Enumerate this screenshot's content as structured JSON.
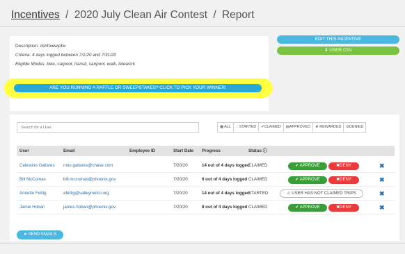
{
  "breadcrumb": {
    "root": "Incentives",
    "separator": "/",
    "contest": "2020 July Clean Air Contest",
    "page": "Report"
  },
  "description": {
    "description_line": "Description: dshfoiewjofei",
    "criteria_line": "Criteria: 4 days logged between 7/1/20 and 7/31/20",
    "modes_line": "Eligible Modes: bike, carpool, transit, vanpool, walk, telework"
  },
  "raffle_button": "ARE YOU RUNNING A RAFFLE OR SWEEPSTAKES? CLICK TO PICK YOUR WINNER!",
  "side_buttons": {
    "edit": "EDIT THIS INCENTIVE",
    "csv": "USER CSV"
  },
  "search": {
    "placeholder": "Search for a User"
  },
  "filters": [
    {
      "label": "ALL",
      "icon": "grid-icon"
    },
    {
      "label": "STARTED",
      "icon": "circle-notch-icon"
    },
    {
      "label": "CLAIMED",
      "icon": "check-icon"
    },
    {
      "label": "APPROVED",
      "icon": "clipboard-icon"
    },
    {
      "label": "REWARDED",
      "icon": "star-icon"
    },
    {
      "label": "DENIED",
      "icon": "ban-icon"
    }
  ],
  "table": {
    "headers": {
      "user": "User",
      "email": "Email",
      "employee_id": "Employee ID",
      "start_date": "Start Date",
      "progress": "Progress",
      "status": "Status"
    },
    "rows": [
      {
        "user": "Celestino Gallares",
        "email": "nino.gallares@chase.com",
        "employee_id": "",
        "start_date": "7/20/20",
        "progress": "14 out of 4 days logged",
        "status": "CLAIMED"
      },
      {
        "user": "Bill McComas",
        "email": "bill.mccomas@phoenix.gov",
        "employee_id": "",
        "start_date": "7/20/20",
        "progress": "6 out of 4 days logged",
        "status": "CLAIMED"
      },
      {
        "user": "Annette Fettig",
        "email": "afettig@valleymetro.org",
        "employee_id": "",
        "start_date": "7/20/20",
        "progress": "14 out of 4 days logged",
        "status": "STARTED"
      },
      {
        "user": "Jamie Hoban",
        "email": "james.hoban@phoenix.gov",
        "employee_id": "",
        "start_date": "7/20/20",
        "progress": "8 out of 4 days logged",
        "status": "CLAIMED"
      }
    ],
    "approve_label": "APPROVE",
    "deny_label": "DENY",
    "not_claimed_label": "USER HAS NOT CLAIMED TRIPS",
    "remove_glyph": "✖"
  },
  "send_emails": "SEND EMAILS",
  "colors": {
    "highlight": "#ffff3a",
    "approve": "#3d9c3a",
    "deny": "#e83c3c",
    "link": "#2a6fa8",
    "primary": "#4db8df",
    "csv": "#7cc242"
  }
}
